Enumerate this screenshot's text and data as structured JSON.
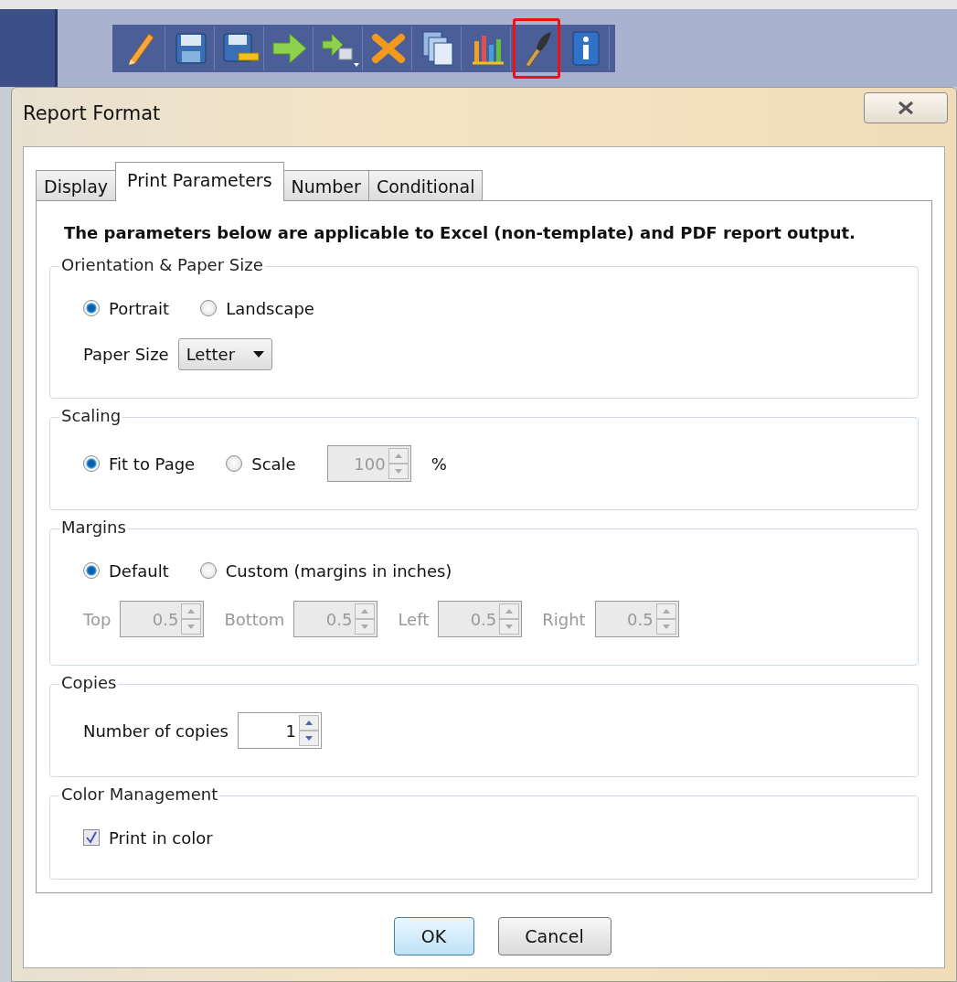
{
  "toolbar": {
    "buttons": [
      {
        "kind": "pencil",
        "highlighted": false
      },
      {
        "kind": "save",
        "highlighted": false
      },
      {
        "kind": "save-as",
        "highlighted": false
      },
      {
        "kind": "arrow",
        "highlighted": false
      },
      {
        "kind": "arrow-add",
        "highlighted": false
      },
      {
        "kind": "delete",
        "highlighted": false
      },
      {
        "kind": "pages",
        "highlighted": false
      },
      {
        "kind": "chart",
        "highlighted": false
      },
      {
        "kind": "brush",
        "highlighted": true
      },
      {
        "kind": "info",
        "highlighted": false
      }
    ]
  },
  "dialog": {
    "title": "Report Format",
    "tabs": [
      {
        "label": "Display",
        "selected": false
      },
      {
        "label": "Print Parameters",
        "selected": true
      },
      {
        "label": "Number",
        "selected": false
      },
      {
        "label": "Conditional",
        "selected": false
      }
    ],
    "note": "The parameters below are applicable to Excel (non-template) and PDF report output.",
    "groups": [
      {
        "title": "Orientation & Paper Size",
        "lines": [
          {
            "items": [
              {
                "kind": "radio",
                "label": "Portrait",
                "selected": true
              },
              {
                "kind": "radio",
                "label": "Landscape",
                "selected": false
              }
            ]
          },
          {
            "items": [
              {
                "kind": "label",
                "text": "Paper Size",
                "disabled": false
              },
              {
                "kind": "dropdown",
                "value": "Letter"
              }
            ]
          }
        ]
      },
      {
        "title": "Scaling",
        "lines": [
          {
            "items": [
              {
                "kind": "radio",
                "label": "Fit to Page",
                "selected": true
              },
              {
                "kind": "radio",
                "label": "Scale",
                "selected": false
              },
              {
                "kind": "spinner",
                "value": "100",
                "disabled": true
              },
              {
                "kind": "label",
                "text": "%",
                "disabled": false
              }
            ]
          }
        ]
      },
      {
        "title": "Margins",
        "lines": [
          {
            "items": [
              {
                "kind": "radio",
                "label": "Default",
                "selected": true
              },
              {
                "kind": "radio",
                "label": "Custom (margins in inches)",
                "selected": false
              }
            ]
          },
          {
            "items": [
              {
                "kind": "label",
                "text": "Top",
                "disabled": true
              },
              {
                "kind": "spinner",
                "value": "0.5",
                "disabled": true
              },
              {
                "kind": "label",
                "text": "Bottom",
                "disabled": true
              },
              {
                "kind": "spinner",
                "value": "0.5",
                "disabled": true
              },
              {
                "kind": "label",
                "text": "Left",
                "disabled": true
              },
              {
                "kind": "spinner",
                "value": "0.5",
                "disabled": true
              },
              {
                "kind": "label",
                "text": "Right",
                "disabled": true
              },
              {
                "kind": "spinner",
                "value": "0.5",
                "disabled": true
              }
            ]
          }
        ]
      },
      {
        "title": "Copies",
        "lines": [
          {
            "items": [
              {
                "kind": "label",
                "text": "Number of copies",
                "disabled": false
              },
              {
                "kind": "spinner",
                "value": "1",
                "disabled": false
              }
            ]
          }
        ]
      },
      {
        "title": "Color Management",
        "lines": [
          {
            "items": [
              {
                "kind": "checkbox",
                "label": "Print in color",
                "checked": true
              }
            ]
          }
        ]
      }
    ],
    "buttons": [
      {
        "label": "OK",
        "default": true
      },
      {
        "label": "Cancel",
        "default": false
      }
    ]
  }
}
